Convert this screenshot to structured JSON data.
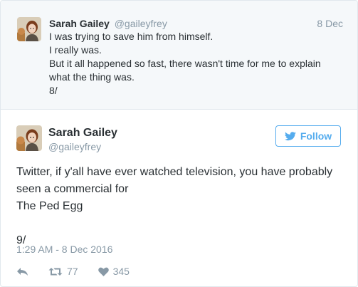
{
  "previous_tweet": {
    "name": "Sarah Gailey",
    "handle": "@gaileyfrey",
    "date": "8 Dec",
    "lines": [
      "I was trying to save him from himself.",
      "I really was.",
      "But it all happened so fast, there wasn't time for me to explain",
      "what the thing was.",
      "8/"
    ]
  },
  "tweet": {
    "name": "Sarah Gailey",
    "handle": "@gaileyfrey",
    "follow_label": "Follow",
    "lines": [
      "Twitter, if y'all have ever watched television, you have probably",
      "seen a commercial for",
      "The Ped Egg",
      "",
      "9/"
    ],
    "timestamp": "1:29 AM - 8 Dec 2016",
    "retweet_count": "77",
    "like_count": "345"
  },
  "colors": {
    "twitter_blue": "#55acee",
    "muted_gray": "#8899a6",
    "context_bg": "#f5f8fa"
  },
  "icons": {
    "reply": "reply-icon",
    "retweet": "retweet-icon",
    "like": "heart-icon",
    "bird": "twitter-bird-icon"
  }
}
